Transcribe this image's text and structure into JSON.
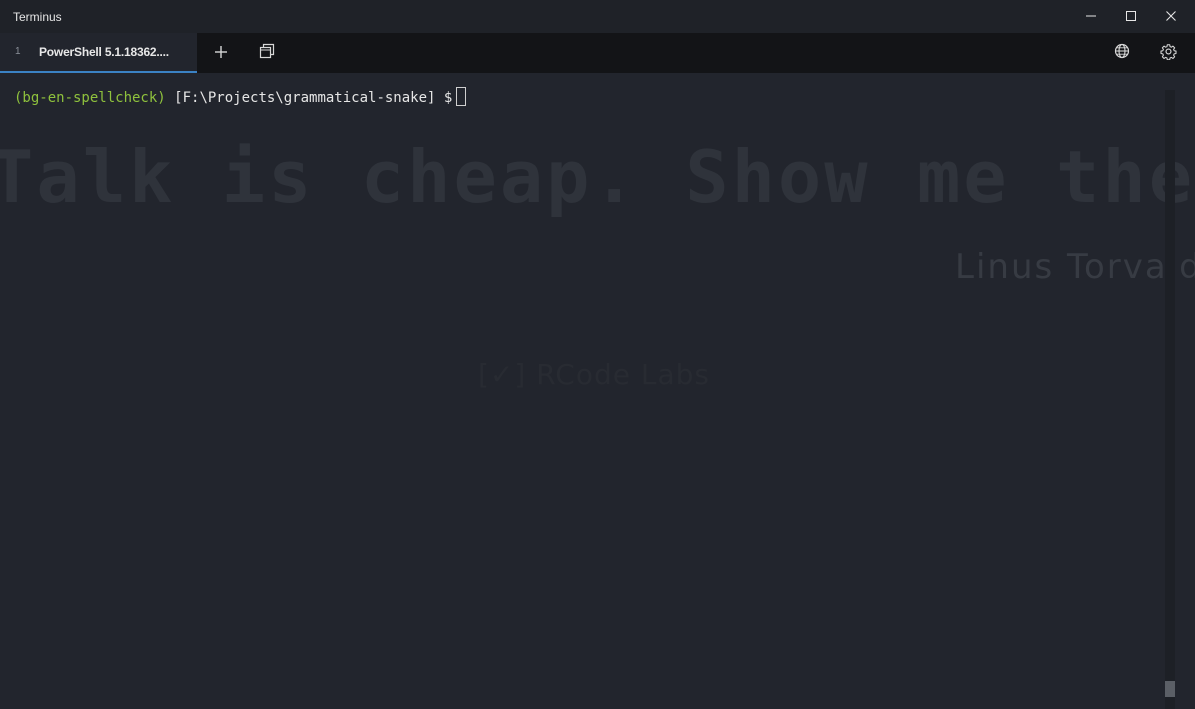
{
  "window": {
    "title": "Terminus"
  },
  "tabs": [
    {
      "index": "1",
      "title": "PowerShell 5.1.18362...."
    }
  ],
  "toolbar": {
    "add_icon": "plus-icon",
    "windows_icon": "windows-icon",
    "globe_icon": "globe-icon",
    "settings_icon": "gear-icon"
  },
  "terminal": {
    "env": "(bg-en-spellcheck)",
    "path": "[F:\\Projects\\grammatical-snake]",
    "prompt_symbol": "$",
    "background_quote": "Talk is cheap. Show me the code.",
    "background_author": "Linus Torvalds",
    "background_credit": "[✓] RCode Labs"
  },
  "colors": {
    "background": "#22252d",
    "titlebar": "#1f2228",
    "tabbar": "#131417",
    "accent": "#3b82c4",
    "env_green": "#8fc23d"
  }
}
